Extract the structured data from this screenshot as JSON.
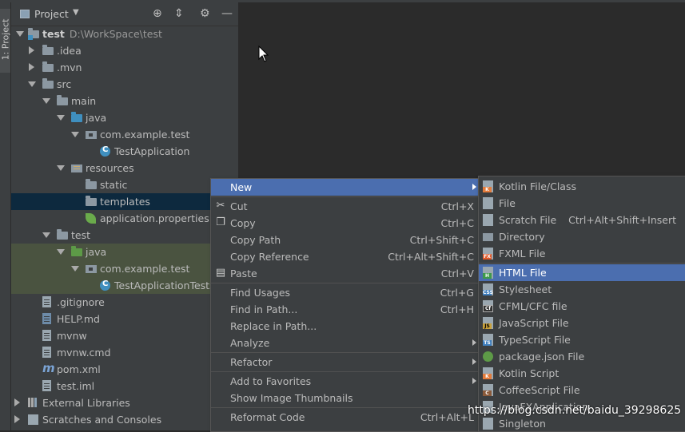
{
  "side_tab": {
    "label": "1: Project"
  },
  "panel": {
    "title": "Project",
    "dropdown_icon": "dropdown-arrow-icon",
    "buttons": [
      "target-icon",
      "collapse-icon",
      "gear-icon",
      "minimize-icon"
    ]
  },
  "tree": [
    {
      "label": "test",
      "path": "D:\\WorkSpace\\test"
    },
    {
      "label": ".idea"
    },
    {
      "label": ".mvn"
    },
    {
      "label": "src"
    },
    {
      "label": "main"
    },
    {
      "label": "java"
    },
    {
      "label": "com.example.test"
    },
    {
      "label": "TestApplication"
    },
    {
      "label": "resources"
    },
    {
      "label": "static"
    },
    {
      "label": "templates"
    },
    {
      "label": "application.properties"
    },
    {
      "label": "test"
    },
    {
      "label": "java"
    },
    {
      "label": "com.example.test"
    },
    {
      "label": "TestApplicationTests"
    },
    {
      "label": ".gitignore"
    },
    {
      "label": "HELP.md"
    },
    {
      "label": "mvnw"
    },
    {
      "label": "mvnw.cmd"
    },
    {
      "label": "pom.xml"
    },
    {
      "label": "test.iml"
    },
    {
      "label": "External Libraries"
    },
    {
      "label": "Scratches and Consoles"
    }
  ],
  "context_menu": [
    {
      "label": "New",
      "shortcut": ""
    },
    {
      "label": "Cut",
      "shortcut": "Ctrl+X"
    },
    {
      "label": "Copy",
      "shortcut": "Ctrl+C"
    },
    {
      "label": "Copy Path",
      "shortcut": "Ctrl+Shift+C"
    },
    {
      "label": "Copy Reference",
      "shortcut": "Ctrl+Alt+Shift+C"
    },
    {
      "label": "Paste",
      "shortcut": "Ctrl+V"
    },
    {
      "label": "Find Usages",
      "shortcut": "Ctrl+G"
    },
    {
      "label": "Find in Path...",
      "shortcut": "Ctrl+H"
    },
    {
      "label": "Replace in Path...",
      "shortcut": ""
    },
    {
      "label": "Analyze",
      "shortcut": ""
    },
    {
      "label": "Refactor",
      "shortcut": ""
    },
    {
      "label": "Add to Favorites",
      "shortcut": ""
    },
    {
      "label": "Show Image Thumbnails",
      "shortcut": ""
    },
    {
      "label": "Reformat Code",
      "shortcut": "Ctrl+Alt+L"
    }
  ],
  "submenu": [
    {
      "label": "Kotlin File/Class",
      "shortcut": "",
      "badge": "K"
    },
    {
      "label": "File",
      "shortcut": "",
      "badge": ""
    },
    {
      "label": "Scratch File",
      "shortcut": "Ctrl+Alt+Shift+Insert",
      "badge": ""
    },
    {
      "label": "Directory",
      "shortcut": "",
      "badge": ""
    },
    {
      "label": "FXML File",
      "shortcut": "",
      "badge": "FX"
    },
    {
      "label": "HTML File",
      "shortcut": "",
      "badge": "H"
    },
    {
      "label": "Stylesheet",
      "shortcut": "",
      "badge": "CSS"
    },
    {
      "label": "CFML/CFC file",
      "shortcut": "",
      "badge": "Cf"
    },
    {
      "label": "JavaScript File",
      "shortcut": "",
      "badge": "JS"
    },
    {
      "label": "TypeScript File",
      "shortcut": "",
      "badge": "TS"
    },
    {
      "label": "package.json File",
      "shortcut": "",
      "badge": ""
    },
    {
      "label": "Kotlin Script",
      "shortcut": "",
      "badge": "K"
    },
    {
      "label": "CoffeeScript File",
      "shortcut": "",
      "badge": "C"
    },
    {
      "label": "JavaFXApplication",
      "shortcut": "",
      "badge": ""
    },
    {
      "label": "Singleton",
      "shortcut": "",
      "badge": ""
    }
  ],
  "watermark": "https://blog.csdn.net/baidu_39298625",
  "colors": {
    "highlight": "#4b6eaf",
    "panel_bg": "#3c3f41",
    "editor_bg": "#2b2b2b",
    "selected_row": "#0d293e",
    "test_row": "#4a5340"
  }
}
